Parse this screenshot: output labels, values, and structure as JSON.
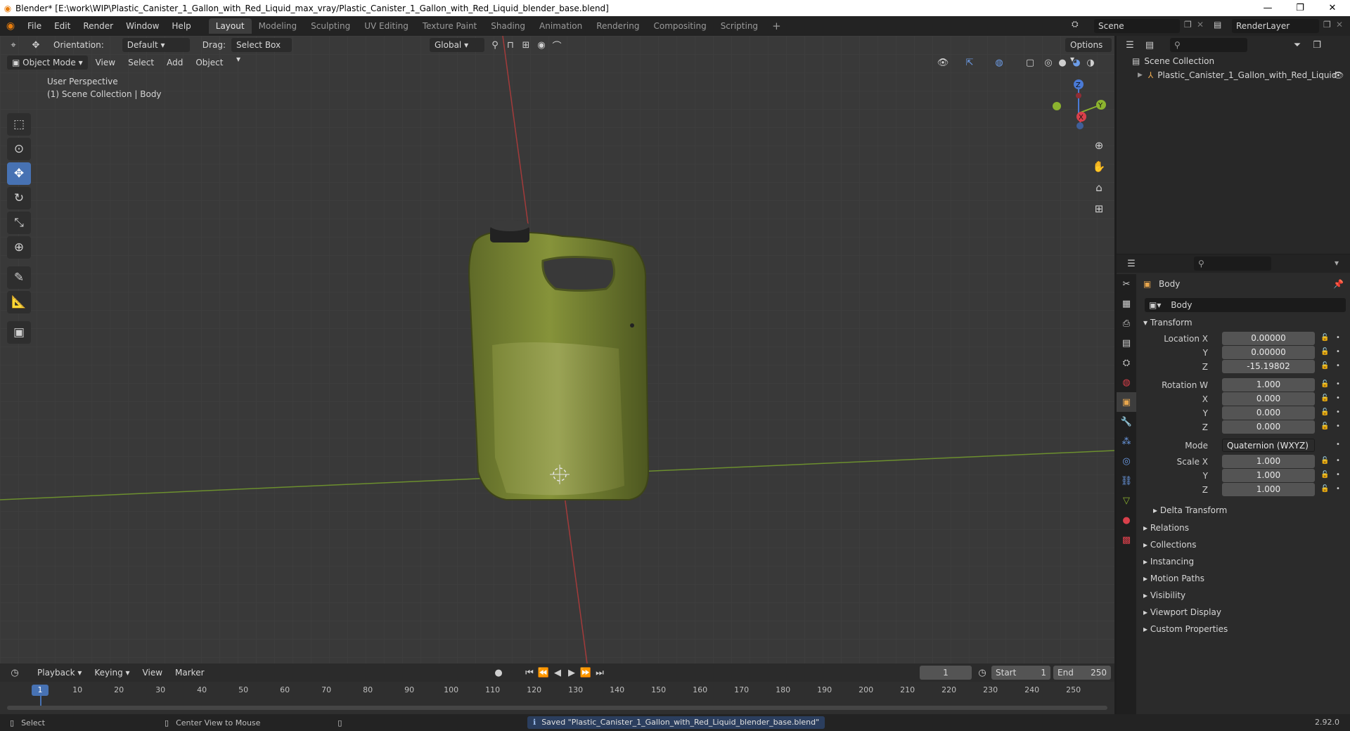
{
  "window": {
    "title": "Blender* [E:\\work\\WIP\\Plastic_Canister_1_Gallon_with_Red_Liquid_max_vray/Plastic_Canister_1_Gallon_with_Red_Liquid_blender_base.blend]"
  },
  "menu": {
    "items": [
      "File",
      "Edit",
      "Render",
      "Window",
      "Help"
    ],
    "workspaces": [
      "Layout",
      "Modeling",
      "Sculpting",
      "UV Editing",
      "Texture Paint",
      "Shading",
      "Animation",
      "Rendering",
      "Compositing",
      "Scripting"
    ],
    "active_workspace": "Layout",
    "scene": "Scene",
    "view_layer": "RenderLayer"
  },
  "viewport_header": {
    "orientation_label": "Orientation:",
    "orientation_value": "Default",
    "drag_label": "Drag:",
    "drag_value": "Select Box",
    "transform_orientation": "Global",
    "options": "Options",
    "mode": "Object Mode",
    "menus": [
      "View",
      "Select",
      "Add",
      "Object"
    ]
  },
  "viewport": {
    "perspective": "User Perspective",
    "collection_info": "(1) Scene Collection | Body",
    "gizmo_axes": [
      "X",
      "Y",
      "Z"
    ]
  },
  "outliner": {
    "root": "Scene Collection",
    "items": [
      "Plastic_Canister_1_Gallon_with_Red_Liquid"
    ]
  },
  "properties": {
    "object_name": "Body",
    "datablock_name": "Body",
    "transform_title": "Transform",
    "location": {
      "x_label": "Location X",
      "y_label": "Y",
      "z_label": "Z",
      "x": "0.00000",
      "y": "0.00000",
      "z": "-15.19802"
    },
    "rotation": {
      "w_label": "Rotation W",
      "x_label": "X",
      "y_label": "Y",
      "z_label": "Z",
      "w": "1.000",
      "x": "0.000",
      "y": "0.000",
      "z": "0.000"
    },
    "mode_label": "Mode",
    "mode_value": "Quaternion (WXYZ)",
    "scale": {
      "x_label": "Scale X",
      "y_label": "Y",
      "z_label": "Z",
      "x": "1.000",
      "y": "1.000",
      "z": "1.000"
    },
    "delta_transform": "Delta Transform",
    "panels": [
      "Relations",
      "Collections",
      "Instancing",
      "Motion Paths",
      "Visibility",
      "Viewport Display",
      "Custom Properties"
    ]
  },
  "timeline": {
    "menus": [
      "Playback",
      "Keying",
      "View",
      "Marker"
    ],
    "current_frame": "1",
    "start_label": "Start",
    "start": "1",
    "end_label": "End",
    "end": "250",
    "ruler": [
      "1",
      "10",
      "20",
      "30",
      "40",
      "50",
      "60",
      "70",
      "80",
      "90",
      "100",
      "110",
      "120",
      "130",
      "140",
      "150",
      "160",
      "170",
      "180",
      "190",
      "200",
      "210",
      "220",
      "230",
      "240",
      "250"
    ]
  },
  "statusbar": {
    "select": "Select",
    "center_view": "Center View to Mouse",
    "message": "Saved \"Plastic_Canister_1_Gallon_with_Red_Liquid_blender_base.blend\"",
    "version": "2.92.0"
  }
}
